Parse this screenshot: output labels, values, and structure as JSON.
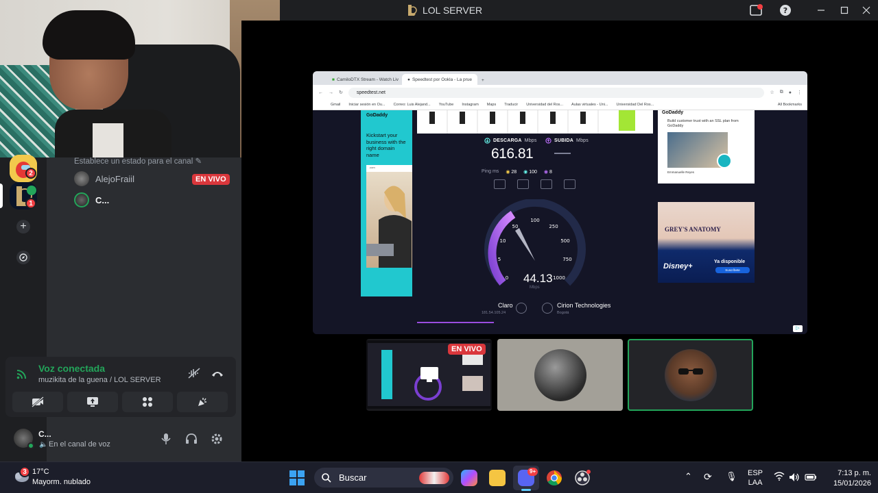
{
  "window": {
    "title": "LOL SERVER",
    "controls": [
      "minimize",
      "maximize",
      "close"
    ]
  },
  "sidebar": {
    "status_prompt": "Establece un estado para el canal",
    "members": [
      {
        "name": "AlejoFraiil",
        "live": true
      },
      {
        "name": "C..."
      }
    ],
    "live_label": "EN VIVO",
    "rail_badges": [
      "2",
      "1"
    ]
  },
  "voice": {
    "title": "Voz conectada",
    "channel": "muzikita de la guena / LOL SERVER"
  },
  "user": {
    "name": "C...",
    "status": "En el canal de voz"
  },
  "browser": {
    "tabs": [
      "CamiloDTX Stream - Watch Liv",
      "Speedtest por Ookla - La prue"
    ],
    "url": "speedtest.net",
    "bookmarks": [
      "Gmail",
      "Iniciar sesión en Ou...",
      "Correo: Luis Alejand...",
      "YouTube",
      "Instagram",
      "Maps",
      "Traducir",
      "Universidad del Ros...",
      "Aulas virtuales - Uni...",
      "Universidad Del Ros...",
      "All Bookmarks"
    ]
  },
  "speedtest": {
    "download_label": "DESCARGA",
    "upload_label": "SUBIDA",
    "unit": "Mbps",
    "download_value": "616.81",
    "ping_label": "Ping",
    "ping_unit": "ms",
    "ping_values": [
      "28",
      "100",
      "8"
    ],
    "gauge_ticks": [
      "0",
      "5",
      "10",
      "50",
      "100",
      "250",
      "500",
      "750",
      "1000"
    ],
    "gauge_value": "44.13",
    "gauge_unit": "Mbps",
    "isp_name": "Claro",
    "isp_ip": "181.54.105.24",
    "server_name": "Cirion Technologies",
    "server_city": "Bogotá"
  },
  "ads": {
    "left_brand": "GoDaddy",
    "left_text": "Kickstart your business with the right domain name",
    "left_domain": ".com",
    "right1_brand": "GoDaddy",
    "right1_text": "Build customer trust with an SSL plan from GoDaddy",
    "right1_name": "Emmanuelle Reyes",
    "right2_show": "GREY'S ANATOMY",
    "right2_brand": "Disney+",
    "right2_avail": "Ya disponible",
    "right2_cta": "Suscríbete"
  },
  "tiles": {
    "live_label": "EN VIVO"
  },
  "taskbar": {
    "weather_temp": "17°C",
    "weather_desc": "Mayorm. nublado",
    "weather_badge": "3",
    "search_label": "Buscar",
    "lang_top": "ESP",
    "lang_bottom": "LAA",
    "time": "7:13 p. m.",
    "date": "15/01/2026",
    "discord_badge": "9+"
  },
  "colors": {
    "discord_green": "#23a55a",
    "live_red": "#da373c",
    "speedtest_purple": "#9b4de0",
    "godaddy_teal": "#21c8cf"
  }
}
